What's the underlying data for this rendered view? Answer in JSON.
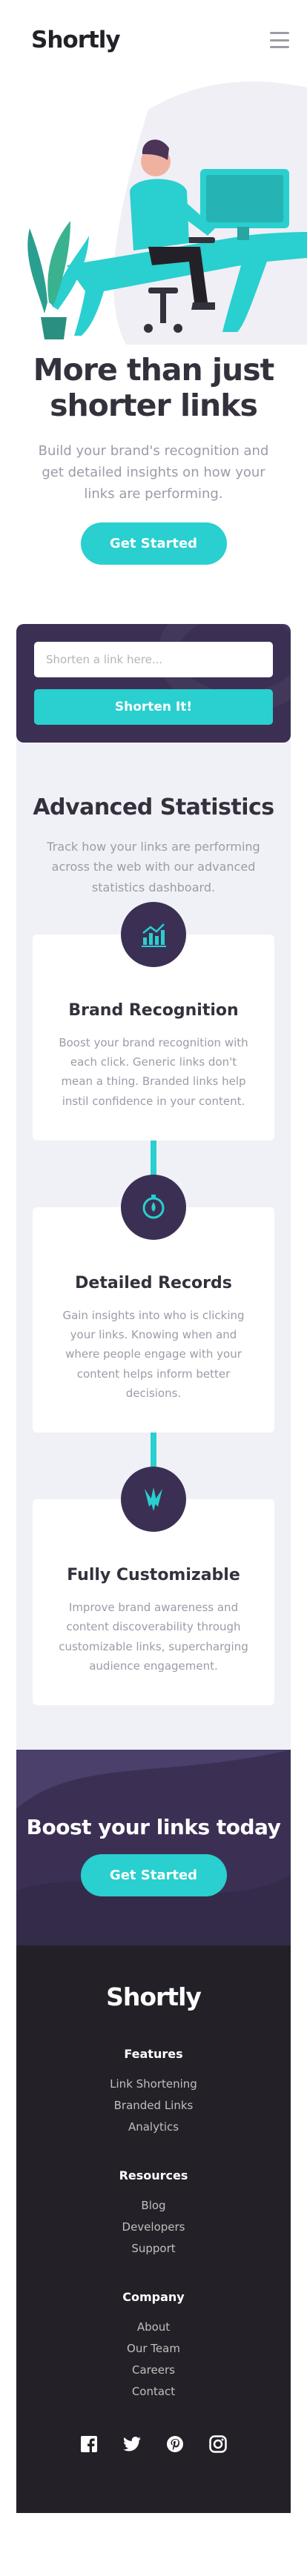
{
  "header": {
    "logo": "Shortly",
    "menu_icon": "hamburger-icon"
  },
  "hero": {
    "title": "More than just shorter links",
    "description": "Build your brand's recognition and get detailed insights on how your links are performing.",
    "cta_label": "Get Started"
  },
  "shortener": {
    "placeholder": "Shorten a link here...",
    "button_label": "Shorten It!"
  },
  "stats": {
    "title": "Advanced Statistics",
    "description": "Track how your links are performing across the web with our advanced statistics dashboard.",
    "cards": [
      {
        "icon": "brand-recognition-icon",
        "title": "Brand Recognition",
        "text": "Boost your brand recognition with each click. Generic links don't mean a thing. Branded links help instil confidence in your content."
      },
      {
        "icon": "detailed-records-icon",
        "title": "Detailed Records",
        "text": "Gain insights into who is clicking your links. Knowing when and where people engage with your content helps inform better decisions."
      },
      {
        "icon": "fully-customizable-icon",
        "title": "Fully Customizable",
        "text": "Improve brand awareness and content discoverability through customizable links, supercharging audience engagement."
      }
    ]
  },
  "boost": {
    "title": "Boost your links today",
    "cta_label": "Get Started"
  },
  "footer": {
    "logo": "Shortly",
    "columns": [
      {
        "heading": "Features",
        "links": [
          "Link Shortening",
          "Branded Links",
          "Analytics"
        ]
      },
      {
        "heading": "Resources",
        "links": [
          "Blog",
          "Developers",
          "Support"
        ]
      },
      {
        "heading": "Company",
        "links": [
          "About",
          "Our Team",
          "Careers",
          "Contact"
        ]
      }
    ],
    "social": [
      "facebook-icon",
      "twitter-icon",
      "pinterest-icon",
      "instagram-icon"
    ]
  },
  "colors": {
    "cyan": "#2acfcf",
    "dark_violet": "#3b3054",
    "very_dark_violet": "#232127",
    "grayish_violet": "#9e9aa7",
    "light_gray": "#f0f1f6"
  }
}
